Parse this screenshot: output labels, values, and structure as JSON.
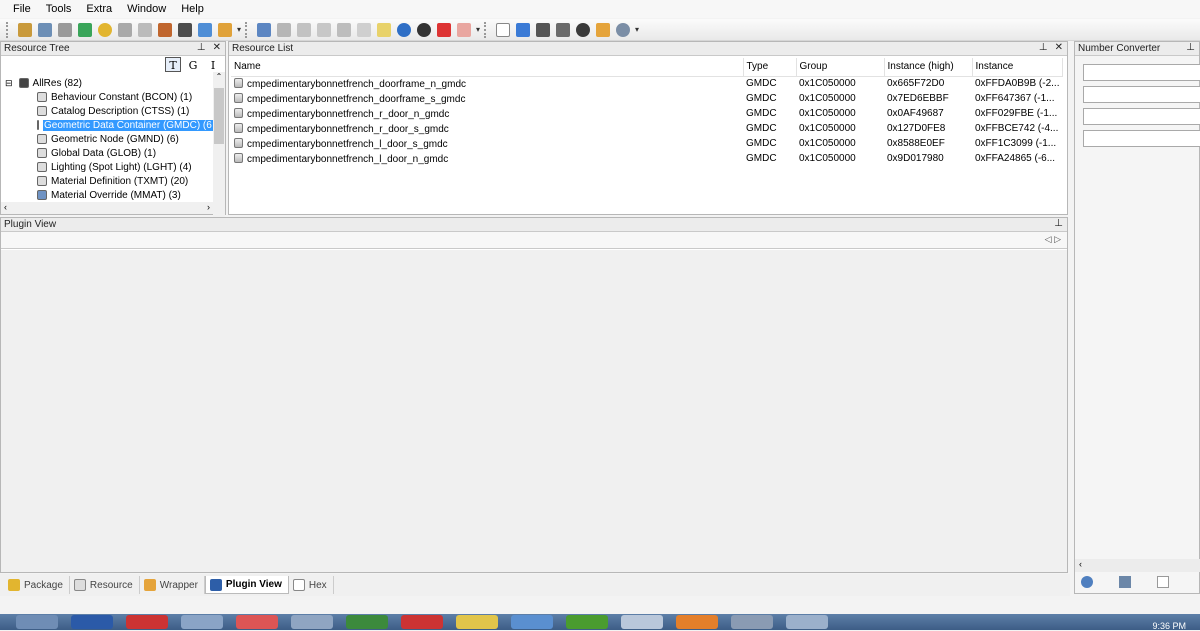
{
  "menu": [
    "File",
    "Tools",
    "Extra",
    "Window",
    "Help"
  ],
  "toolbar_icons_1": [
    "open-package-icon",
    "save-icon",
    "link-icon",
    "refresh-icon",
    "star-icon",
    "clip-icon",
    "cut-icon",
    "import-icon",
    "camera-icon",
    "tools-icon",
    "person-icon"
  ],
  "toolbar_icons_2": [
    "export-icon",
    "save-disk-icon",
    "copy-icon",
    "paste-icon",
    "comment-icon",
    "list-icon",
    "note-icon",
    "sync-icon",
    "locked-icon",
    "delete-icon",
    "eraser-icon"
  ],
  "toolbar_icons_3": [
    "new-file-icon",
    "folder-open-icon",
    "floppy-icon",
    "floppy-star-icon",
    "close-circle-icon",
    "users-icon",
    "search-web-icon"
  ],
  "resource_tree": {
    "title": "Resource Tree",
    "toggles": [
      "T",
      "G",
      "I"
    ],
    "items": [
      {
        "label": "AllRes (82)",
        "selected": false
      },
      {
        "label": "Behaviour Constant (BCON) (1)",
        "selected": false
      },
      {
        "label": "Catalog Description (CTSS) (1)",
        "selected": false
      },
      {
        "label": "Geometric Data Container (GMDC) (6",
        "selected": true
      },
      {
        "label": "Geometric Node (GMND) (6)",
        "selected": false
      },
      {
        "label": "Global Data (GLOB) (1)",
        "selected": false
      },
      {
        "label": "Lighting (Spot Light) (LGHT) (4)",
        "selected": false
      },
      {
        "label": "Material Definition (TXMT) (20)",
        "selected": false
      },
      {
        "label": "Material Override (MMAT) (3)",
        "selected": false
      }
    ]
  },
  "resource_list": {
    "title": "Resource List",
    "columns": [
      "Name",
      "Type",
      "Group",
      "Instance (high)",
      "Instance"
    ],
    "rows": [
      [
        "cmpedimentarybonnetfrench_doorframe_n_gmdc",
        "GMDC",
        "0x1C050000",
        "0x665F72D0",
        "0xFFDA0B9B (-2..."
      ],
      [
        "cmpedimentarybonnetfrench_doorframe_s_gmdc",
        "GMDC",
        "0x1C050000",
        "0x7ED6EBBF",
        "0xFF647367 (-1..."
      ],
      [
        "cmpedimentarybonnetfrench_r_door_n_gmdc",
        "GMDC",
        "0x1C050000",
        "0x0AF49687",
        "0xFF029FBE (-1..."
      ],
      [
        "cmpedimentarybonnetfrench_r_door_s_gmdc",
        "GMDC",
        "0x1C050000",
        "0x127D0FE8",
        "0xFFBCE742 (-4..."
      ],
      [
        "cmpedimentarybonnetfrench_l_door_s_gmdc",
        "GMDC",
        "0x1C050000",
        "0x8588E0EF",
        "0xFF1C3099 (-1..."
      ],
      [
        "cmpedimentarybonnetfrench_l_door_n_gmdc",
        "GMDC",
        "0x1C050000",
        "0x9D017980",
        "0xFFA24865 (-6..."
      ]
    ]
  },
  "plugin_view": {
    "title": "Plugin View"
  },
  "number_converter": {
    "title": "Number Converter"
  },
  "bottom_tabs": [
    {
      "label": "Package",
      "active": false
    },
    {
      "label": "Resource",
      "active": false
    },
    {
      "label": "Wrapper",
      "active": false
    },
    {
      "label": "Plugin View",
      "active": true
    },
    {
      "label": "Hex",
      "active": false
    }
  ],
  "taskbar": {
    "time": "9:36 PM"
  },
  "colors": {
    "selection": "#3399ff",
    "taskbar": "#4a6b95"
  }
}
